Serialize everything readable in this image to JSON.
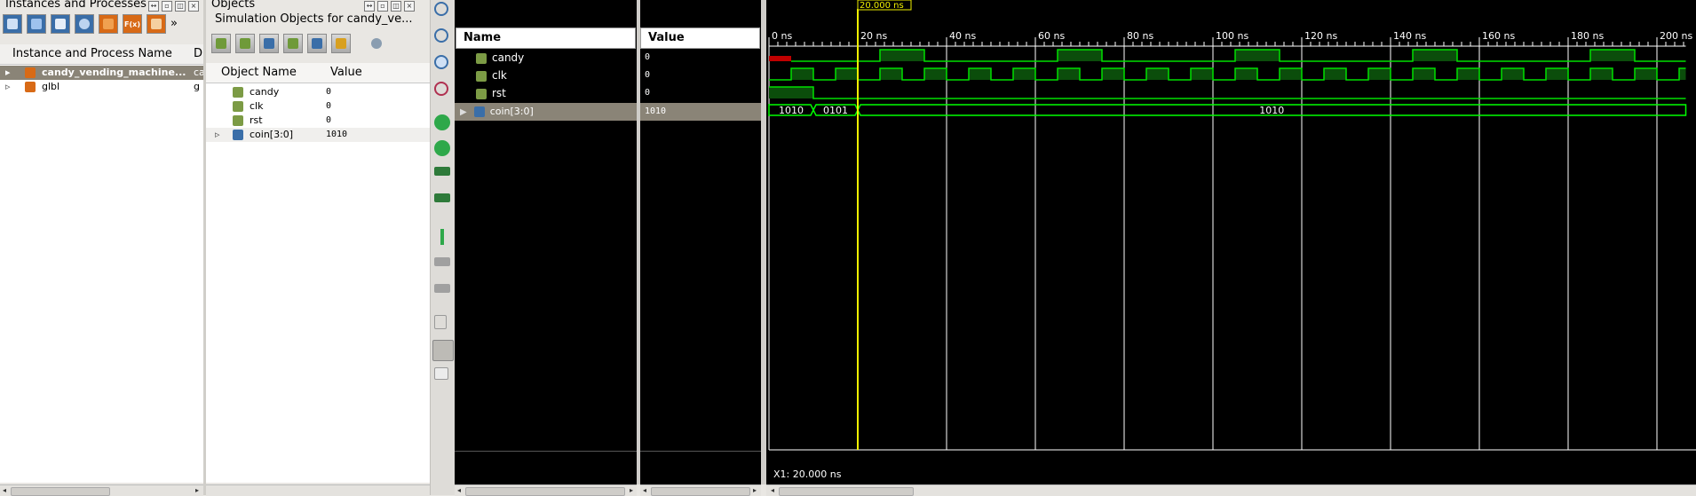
{
  "instances": {
    "title": "Instances and Processes",
    "columns": [
      "Instance and Process Name",
      "D"
    ],
    "rows": [
      {
        "name": "candy_vending_machine...",
        "value": "ca"
      },
      {
        "name": "glbl",
        "value": "g"
      }
    ]
  },
  "objects": {
    "title": "Objects",
    "subtitle": "Simulation Objects for candy_ve...",
    "columns": [
      "Object Name",
      "Value"
    ],
    "rows": [
      {
        "name": "candy",
        "value": "0"
      },
      {
        "name": "clk",
        "value": "0"
      },
      {
        "name": "rst",
        "value": "0"
      },
      {
        "name": "coin[3:0]",
        "value": "1010"
      }
    ]
  },
  "wave": {
    "name_header": "Name",
    "value_header": "Value",
    "signals": [
      {
        "name": "candy",
        "value": "0"
      },
      {
        "name": "clk",
        "value": "0"
      },
      {
        "name": "rst",
        "value": "0"
      },
      {
        "name": "coin[3:0]",
        "value": "1010"
      }
    ],
    "cursor_label": "20.000 ns",
    "cursor_time": 20,
    "status": "X1: 20.000 ns",
    "time_ticks": [
      "0 ns",
      "20 ns",
      "40 ns",
      "60 ns",
      "80 ns",
      "100 ns",
      "120 ns",
      "140 ns",
      "160 ns",
      "180 ns",
      "200 ns"
    ],
    "bus_values": [
      "1010",
      "0101",
      "1010"
    ],
    "colors": {
      "wave": "#00e000",
      "cursor": "#f0f000",
      "bus": "#00ff00"
    }
  }
}
